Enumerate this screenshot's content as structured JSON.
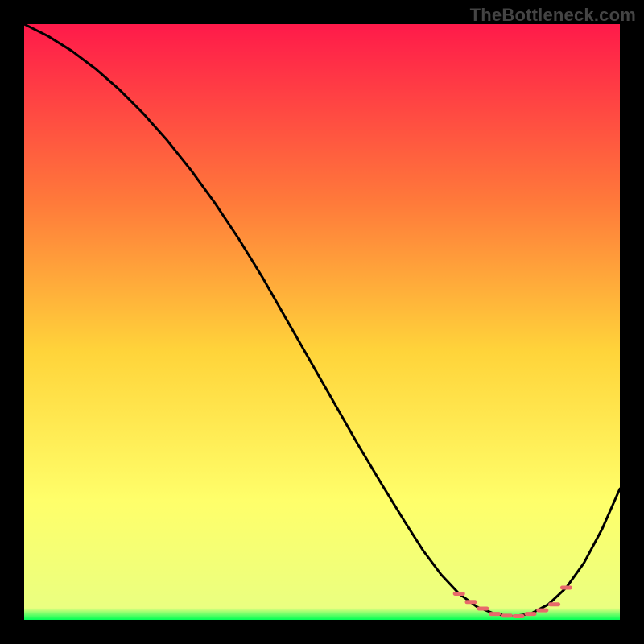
{
  "watermark": "TheBottleneck.com",
  "colors": {
    "background": "#000000",
    "gradient_top": "#ff1a4a",
    "gradient_mid1": "#ff7a3a",
    "gradient_mid2": "#ffd43a",
    "gradient_mid3": "#ffff6a",
    "gradient_bottom": "#00ff55",
    "line": "#000000",
    "marker": "#e86a6a"
  },
  "chart_data": {
    "type": "line",
    "title": "",
    "xlabel": "",
    "ylabel": "",
    "xlim": [
      0,
      100
    ],
    "ylim": [
      0,
      100
    ],
    "series": [
      {
        "name": "curve",
        "x": [
          0,
          4,
          8,
          12,
          16,
          20,
          24,
          28,
          32,
          36,
          40,
          44,
          48,
          52,
          56,
          60,
          64,
          67,
          70,
          73,
          76,
          79,
          82,
          85,
          88,
          91,
          94,
          97,
          100
        ],
        "y": [
          100,
          98,
          95.5,
          92.5,
          89,
          85,
          80.5,
          75.5,
          70,
          64,
          57.5,
          50.5,
          43.5,
          36.5,
          29.5,
          22.8,
          16.3,
          11.6,
          7.6,
          4.4,
          2.2,
          1.0,
          0.6,
          1.0,
          2.6,
          5.4,
          9.6,
          15.2,
          22.0
        ]
      }
    ],
    "markers": {
      "name": "highlight-band",
      "x": [
        73,
        75,
        77,
        79,
        81,
        83,
        85,
        87,
        89,
        91
      ],
      "y": [
        4.4,
        3.0,
        1.9,
        1.0,
        0.7,
        0.6,
        1.0,
        1.6,
        2.6,
        5.4
      ]
    }
  }
}
